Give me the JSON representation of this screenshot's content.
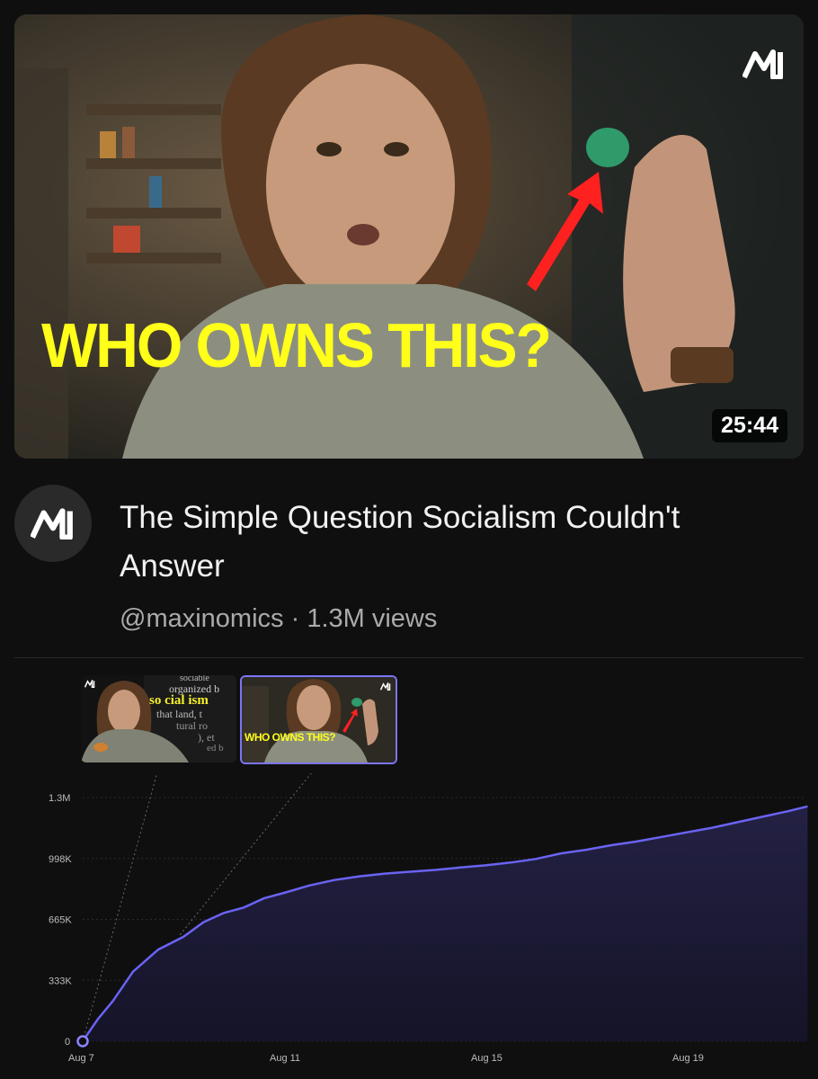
{
  "video": {
    "thumbnail_text": "WHO OWNS THIS?",
    "duration": "25:44",
    "title": "The Simple Question Socialism Couldn't Answer",
    "channel_handle": "@maxinomics",
    "separator": "·",
    "views": "1.3M views"
  },
  "comparison_thumbnails": [
    {
      "lines": [
        "sociable",
        "organized b",
        "so cial ism",
        "that land, t",
        "tural  ro",
        "), et",
        "ed b"
      ]
    },
    {
      "caption": "WHO OWNS THIS?"
    }
  ],
  "colors": {
    "accent": "#7b75f5",
    "caption_yellow": "#ffff1a",
    "background": "#0f0f0f"
  },
  "chart_data": {
    "type": "area",
    "x_ticks": [
      "Aug 7",
      "Aug 11",
      "Aug 15",
      "Aug 19"
    ],
    "y_ticks": [
      "0",
      "333K",
      "665K",
      "998K",
      "1.3M"
    ],
    "ylim": [
      0,
      1330000
    ],
    "grid": true,
    "series": [
      {
        "x": [
          7.0,
          7.1,
          7.3,
          7.6,
          8.0,
          8.5,
          9.0,
          9.4,
          9.8,
          10.2,
          10.6,
          11.0,
          11.5,
          12.0,
          12.5,
          13.0,
          13.5,
          14.0,
          14.5,
          15.0,
          15.5,
          16.0,
          16.5,
          17.0,
          17.5,
          18.0,
          18.5,
          19.0,
          19.5,
          20.0,
          20.5,
          21.0,
          21.4
        ],
        "y": [
          0,
          40000,
          120000,
          220000,
          380000,
          500000,
          570000,
          650000,
          700000,
          730000,
          780000,
          810000,
          850000,
          880000,
          900000,
          915000,
          925000,
          935000,
          948000,
          960000,
          975000,
          995000,
          1025000,
          1045000,
          1070000,
          1090000,
          1115000,
          1140000,
          1165000,
          1195000,
          1225000,
          1255000,
          1282000
        ]
      }
    ]
  }
}
